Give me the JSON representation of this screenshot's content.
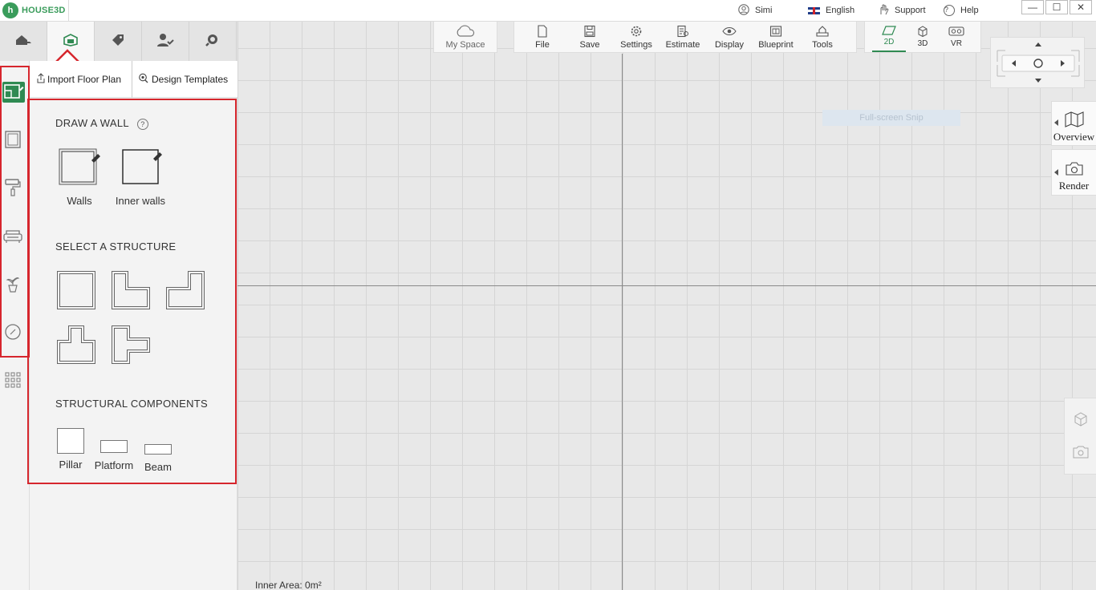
{
  "app": {
    "name": "HOUSE3D",
    "logo_letter": "h"
  },
  "titlebar": {
    "user": "Simi",
    "language": "English",
    "support": "Support",
    "help": "Help",
    "window_buttons": [
      "—",
      "☐",
      "✕"
    ]
  },
  "category_tabs": [
    {
      "name": "home-design",
      "icon": "house-hand-icon"
    },
    {
      "name": "floor-plan",
      "icon": "floor-plan-icon",
      "active": true
    },
    {
      "name": "tags",
      "icon": "tag-icon"
    },
    {
      "name": "account",
      "icon": "user-check-icon"
    },
    {
      "name": "search",
      "icon": "search-icon"
    }
  ],
  "subtabs": {
    "import": "Import Floor Plan",
    "templates": "Design Templates"
  },
  "rail": [
    "floor-plan-edit-icon",
    "frame-icon",
    "paint-roller-icon",
    "sofa-icon",
    "plant-icon",
    "compass-icon",
    "grid-apps-icon"
  ],
  "panel": {
    "draw_wall": {
      "title": "DRAW A WALL",
      "help": "?",
      "tools": [
        {
          "label": "Walls"
        },
        {
          "label": "Inner walls"
        }
      ]
    },
    "structure": {
      "title": "SELECT A STRUCTURE",
      "shapes": [
        "square",
        "l-shape",
        "l-shape-mirrored",
        "t-shape",
        "plus-shape"
      ]
    },
    "components": {
      "title": "STRUCTURAL COMPONENTS",
      "items": [
        {
          "label": "Pillar"
        },
        {
          "label": "Platform"
        },
        {
          "label": "Beam"
        }
      ]
    }
  },
  "toolbar": {
    "my_space": "My Space",
    "main": [
      {
        "label": "File",
        "icon": "file-icon"
      },
      {
        "label": "Save",
        "icon": "save-icon"
      },
      {
        "label": "Settings",
        "icon": "gear-icon"
      },
      {
        "label": "Estimate",
        "icon": "estimate-icon"
      },
      {
        "label": "Display",
        "icon": "eye-icon"
      },
      {
        "label": "Blueprint",
        "icon": "blueprint-icon"
      },
      {
        "label": "Tools",
        "icon": "tools-icon"
      }
    ],
    "views": [
      {
        "label": "2D",
        "active": true
      },
      {
        "label": "3D"
      },
      {
        "label": "VR"
      }
    ]
  },
  "side": {
    "overview": "Overview",
    "render": "Render"
  },
  "overlay": {
    "snip": "Full-screen Snip"
  },
  "status": {
    "inner_area": "Inner Area: 0m²"
  },
  "colors": {
    "accent": "#2f8a52",
    "highlight": "#d6262d",
    "brand": "#3a9c5b"
  }
}
